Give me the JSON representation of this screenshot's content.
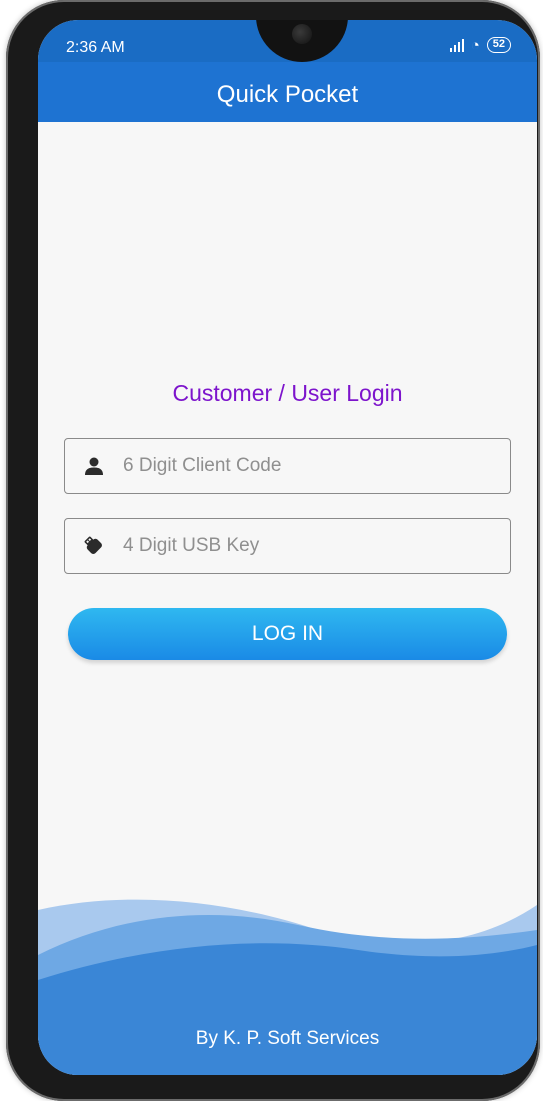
{
  "status_bar": {
    "time": "2:36 AM",
    "battery": "52",
    "wifi_icon": "wifi-icon",
    "signal_icon": "signal-icon"
  },
  "app_bar": {
    "title": "Quick Pocket"
  },
  "login": {
    "heading": "Customer / User Login",
    "client_code": {
      "placeholder": "6 Digit Client Code",
      "value": "",
      "icon": "person-icon"
    },
    "usb_key": {
      "placeholder": "4 Digit USB Key",
      "value": "",
      "icon": "usb-key-icon"
    },
    "button_label": "LOG IN"
  },
  "footer": {
    "text": "By K. P. Soft Services"
  },
  "colors": {
    "app_bar": "#1e73d2",
    "heading": "#7d14cc",
    "button_top": "#2fb8f0",
    "button_bottom": "#1a8ae6",
    "wave": "#3a86d6"
  }
}
